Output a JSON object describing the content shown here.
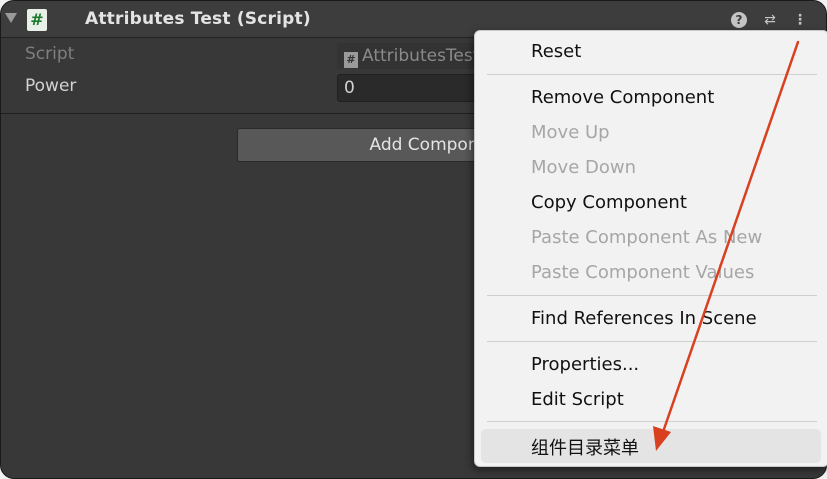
{
  "header": {
    "title": "Attributes Test (Script)",
    "script_icon_glyph": "#",
    "help_icon_glyph": "?",
    "preset_icon_glyph": "⇄",
    "kebab_icon_glyph": "⋮"
  },
  "properties": {
    "script_label": "Script",
    "script_value": "AttributesTest",
    "power_label": "Power",
    "power_value": "0"
  },
  "add_component_label": "Add Component",
  "context_menu": {
    "items": [
      {
        "label": "Reset",
        "enabled": true
      },
      {
        "label": "Remove Component",
        "enabled": true
      },
      {
        "label": "Move Up",
        "enabled": false
      },
      {
        "label": "Move Down",
        "enabled": false
      },
      {
        "label": "Copy Component",
        "enabled": true
      },
      {
        "label": "Paste Component As New",
        "enabled": false
      },
      {
        "label": "Paste Component Values",
        "enabled": false
      },
      {
        "label": "Find References In Scene",
        "enabled": true
      },
      {
        "label": "Properties...",
        "enabled": true
      },
      {
        "label": "Edit Script",
        "enabled": true
      },
      {
        "label": "组件目录菜单",
        "enabled": true,
        "highlighted": true
      }
    ]
  },
  "colors": {
    "annotation_arrow": "#d8401f",
    "inspector_bg": "#383838",
    "menu_bg": "#f2f2f2"
  }
}
